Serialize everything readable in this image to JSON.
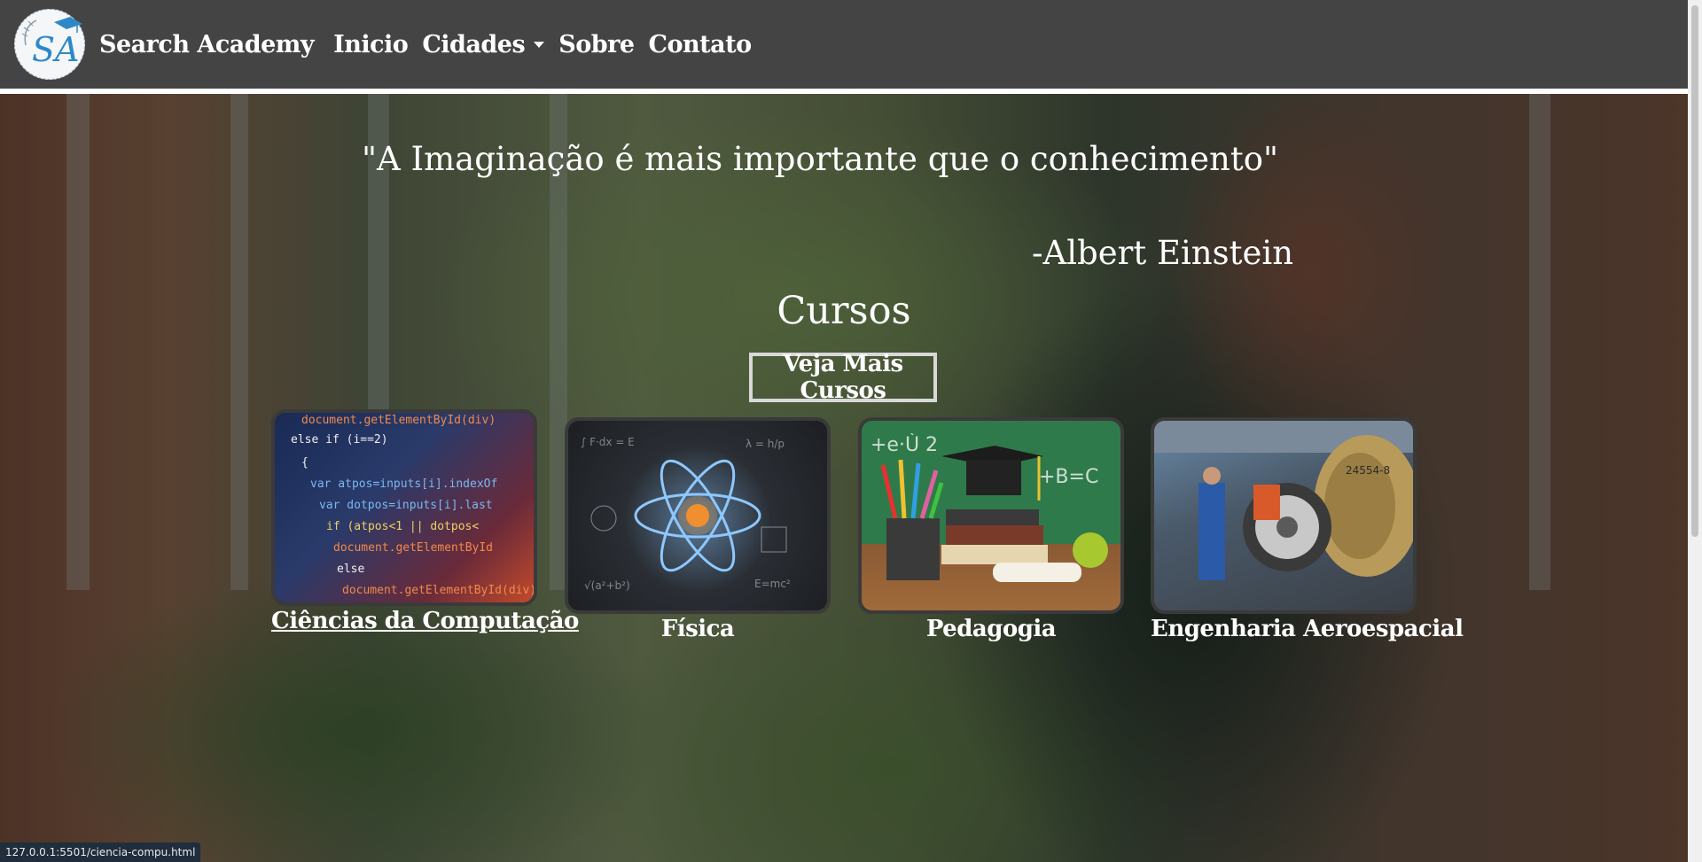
{
  "navbar": {
    "logo_monogram": "SA",
    "brand": "Search Academy",
    "links": [
      {
        "label": "Inicio"
      },
      {
        "label": "Cidades"
      },
      {
        "label": "Sobre"
      },
      {
        "label": "Contato"
      }
    ]
  },
  "hero": {
    "quote": "\"A Imaginação é mais importante que o conhecimento\"",
    "author": "-Albert Einstein"
  },
  "courses": {
    "title": "Cursos",
    "more_button": "Veja Mais Cursos",
    "items": [
      {
        "label": "Ciências da Computação",
        "image": "code-screen"
      },
      {
        "label": "Física",
        "image": "atom"
      },
      {
        "label": "Pedagogia",
        "image": "books-graduation-cap"
      },
      {
        "label": "Engenharia Aeroespacial",
        "image": "jet-engine"
      }
    ]
  },
  "status_bar": {
    "url": "127.0.0.1:5501/ciencia-compu.html"
  },
  "colors": {
    "navbar_bg": "#444444",
    "text": "#ffffff",
    "logo_accent": "#2e88c8"
  }
}
